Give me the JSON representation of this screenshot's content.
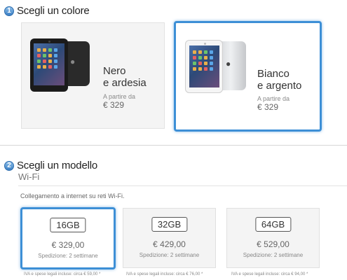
{
  "step1": {
    "number": "1",
    "title": "Scegli un colore"
  },
  "colors": [
    {
      "name_line1": "Nero",
      "name_line2": "e ardesia",
      "from_line1": "A partire da",
      "price": "€ 329"
    },
    {
      "name_line1": "Bianco",
      "name_line2": "e argento",
      "from_line1": "A partire da",
      "price": "€ 329"
    }
  ],
  "step2": {
    "number": "2",
    "title": "Scegli un modello"
  },
  "wifi": {
    "title": "Wi-Fi",
    "description": "Collegamento a internet su reti Wi-Fi."
  },
  "models": [
    {
      "capacity": "16GB",
      "price": "€ 329,00",
      "shipping": "Spedizione: 2 settimane",
      "vat": "IVA e spese legali incluse: circa € 59,00 *"
    },
    {
      "capacity": "32GB",
      "price": "€ 429,00",
      "shipping": "Spedizione: 2 settimane",
      "vat": "IVA e spese legali incluse: circa € 76,00 *"
    },
    {
      "capacity": "64GB",
      "price": "€ 529,00",
      "shipping": "Spedizione: 2 settimane",
      "vat": "IVA e spese legali incluse: circa € 94,00 *"
    }
  ],
  "colors_meta": {
    "accent": "#3d8fd6",
    "card_bg": "#f4f4f4"
  }
}
